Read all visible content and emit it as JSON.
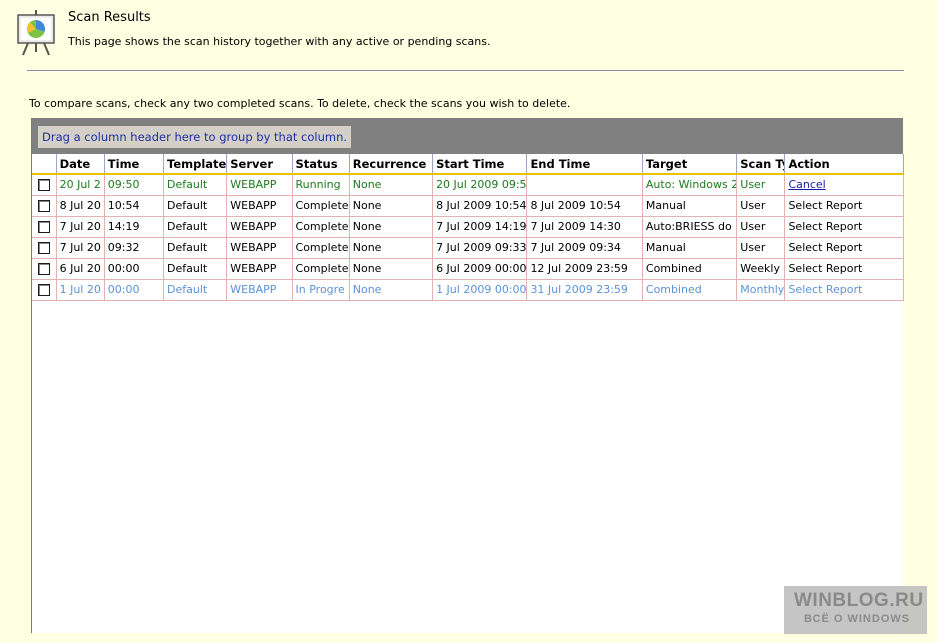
{
  "header": {
    "title": "Scan Results",
    "subtitle": "This page shows the scan history together with any active or pending scans.",
    "icon": "presentation-chart-icon"
  },
  "instructions": "To compare scans, check any two completed scans. To delete, check the scans you wish to delete.",
  "grid": {
    "group_hint": "Drag a column header here to group by that column.",
    "columns": [
      "Date",
      "Time",
      "Template",
      "Server",
      "Status",
      "Recurrence",
      "Start Time",
      "End Time",
      "Target",
      "Scan Ty",
      "Action"
    ],
    "rows": [
      {
        "date": "20 Jul 2",
        "time": "09:50",
        "template": "Default",
        "server": "WEBAPP",
        "status": "Running",
        "recurrence": "None",
        "start": "20 Jul 2009 09:5",
        "end": "",
        "target": "Auto: Windows 2",
        "scantype": "User",
        "action": "Cancel"
      },
      {
        "date": "8 Jul 20",
        "time": "10:54",
        "template": "Default",
        "server": "WEBAPP",
        "status": "Complete",
        "recurrence": "None",
        "start": "8 Jul 2009 10:54",
        "end": "8 Jul 2009 10:54",
        "target": "Manual",
        "scantype": "User",
        "action": "Select Report"
      },
      {
        "date": "7 Jul 20",
        "time": "14:19",
        "template": "Default",
        "server": "WEBAPP",
        "status": "Complete",
        "recurrence": "None",
        "start": "7 Jul 2009 14:19",
        "end": "7 Jul 2009 14:30",
        "target": "Auto:BRIESS do",
        "scantype": "User",
        "action": "Select Report"
      },
      {
        "date": "7 Jul 20",
        "time": "09:32",
        "template": "Default",
        "server": "WEBAPP",
        "status": "Complete",
        "recurrence": "None",
        "start": "7 Jul 2009 09:33",
        "end": "7 Jul 2009 09:34",
        "target": "Manual",
        "scantype": "User",
        "action": "Select Report"
      },
      {
        "date": "6 Jul 20",
        "time": "00:00",
        "template": "Default",
        "server": "WEBAPP",
        "status": "Complete",
        "recurrence": "None",
        "start": "6 Jul 2009 00:00",
        "end": "12 Jul 2009 23:59",
        "target": "Combined",
        "scantype": "Weekly",
        "action": "Select Report"
      },
      {
        "date": "1 Jul 20",
        "time": "00:00",
        "template": "Default",
        "server": "WEBAPP",
        "status": "In Progre",
        "recurrence": "None",
        "start": "1 Jul 2009 00:00",
        "end": "31 Jul 2009 23:59",
        "target": "Combined",
        "scantype": "Monthly",
        "action": "Select Report"
      }
    ]
  },
  "watermark": {
    "line1": "WINBLOG.RU",
    "line2": "ВСЁ О WINDOWS"
  },
  "colors": {
    "background": "#ffffe1",
    "running_text": "#1c7a1c",
    "in_progress_text": "#5b93d8",
    "header_underline": "#e8c300",
    "row_border": "#e1b3b3",
    "group_panel": "#808080"
  }
}
